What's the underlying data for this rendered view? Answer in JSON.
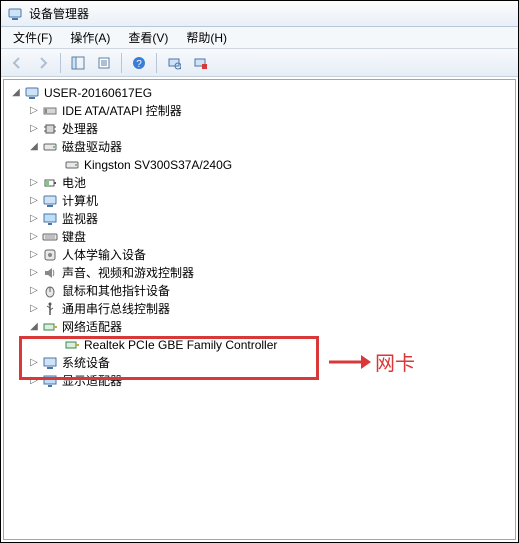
{
  "window": {
    "title": "设备管理器"
  },
  "menu": {
    "file": "文件(F)",
    "action": "操作(A)",
    "view": "查看(V)",
    "help": "帮助(H)"
  },
  "tree": {
    "root": "USER-20160617EG",
    "items": [
      {
        "label": "IDE ATA/ATAPI 控制器",
        "icon": "ide"
      },
      {
        "label": "处理器",
        "icon": "cpu"
      },
      {
        "label": "磁盘驱动器",
        "icon": "disk",
        "expanded": true,
        "child": "Kingston SV300S37A/240G",
        "child_icon": "hdd"
      },
      {
        "label": "电池",
        "icon": "battery"
      },
      {
        "label": "计算机",
        "icon": "computer"
      },
      {
        "label": "监视器",
        "icon": "monitor"
      },
      {
        "label": "键盘",
        "icon": "keyboard"
      },
      {
        "label": "人体学输入设备",
        "icon": "hid"
      },
      {
        "label": "声音、视频和游戏控制器",
        "icon": "sound"
      },
      {
        "label": "鼠标和其他指针设备",
        "icon": "mouse"
      },
      {
        "label": "通用串行总线控制器",
        "icon": "usb"
      },
      {
        "label": "网络适配器",
        "icon": "network",
        "expanded": true,
        "child": "Realtek PCIe GBE Family Controller",
        "child_icon": "network"
      },
      {
        "label": "系统设备",
        "icon": "system"
      },
      {
        "label": "显示适配器",
        "icon": "display"
      }
    ]
  },
  "annotation": {
    "arrow_label": "网卡"
  }
}
